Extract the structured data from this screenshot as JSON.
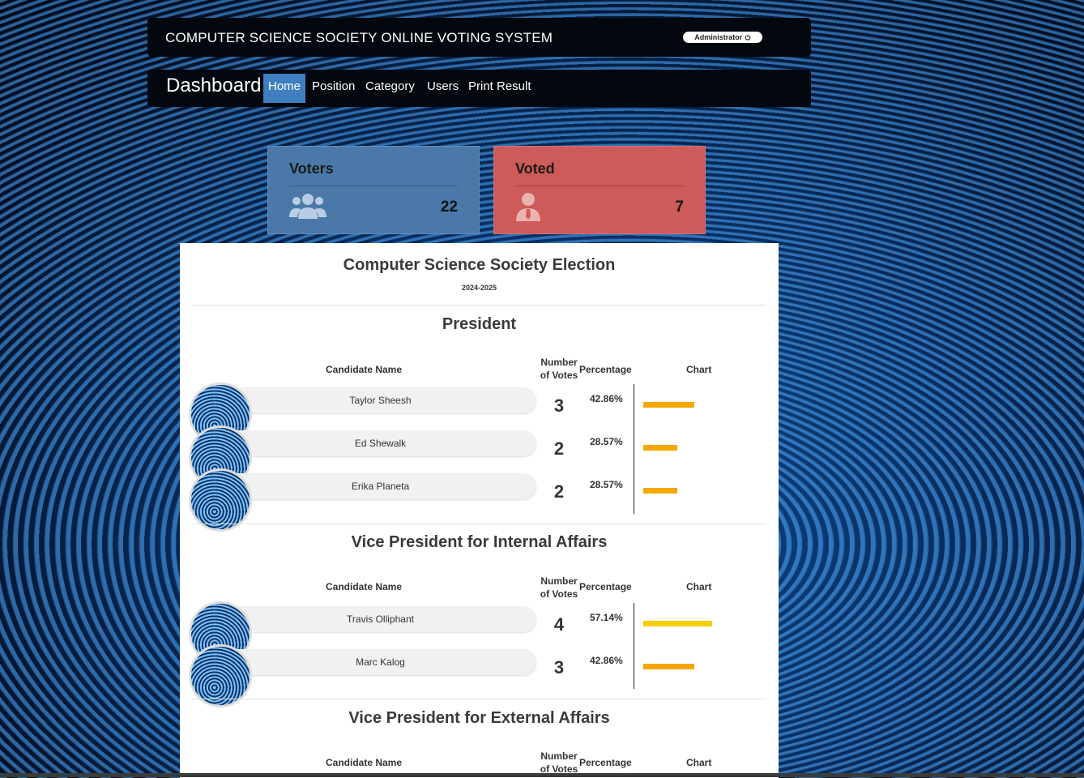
{
  "header": {
    "title": "COMPUTER SCIENCE SOCIETY ONLINE VOTING SYSTEM",
    "admin_label": "Administrator",
    "admin_icon": "power-icon"
  },
  "nav": {
    "brand": "Dashboard",
    "items": [
      {
        "label": "Home",
        "active": true
      },
      {
        "label": "Position",
        "active": false
      },
      {
        "label": "Category",
        "active": false
      },
      {
        "label": "Users",
        "active": false
      },
      {
        "label": "Print Result",
        "active": false
      }
    ]
  },
  "stats": {
    "voters": {
      "label": "Voters",
      "value": "22",
      "icon": "users-icon",
      "color": "#4a79a9"
    },
    "voted": {
      "label": "Voted",
      "value": "7",
      "icon": "user-tie-icon",
      "color": "#cd5b59"
    }
  },
  "election": {
    "title": "Computer Science Society Election",
    "year": "2024-2025",
    "columns": {
      "candidate": "Candidate Name",
      "votes_line1": "Number",
      "votes_line2": "of Votes",
      "percentage": "Percentage",
      "chart": "Chart"
    },
    "positions": [
      {
        "title": "President",
        "candidates": [
          {
            "name": "Taylor Sheesh",
            "votes": "3",
            "percentage": "42.86%",
            "share": 0.4286,
            "bar_color": "#f5a800"
          },
          {
            "name": "Ed Shewalk",
            "votes": "2",
            "percentage": "28.57%",
            "share": 0.2857,
            "bar_color": "#f5a800"
          },
          {
            "name": "Erika Planeta",
            "votes": "2",
            "percentage": "28.57%",
            "share": 0.2857,
            "bar_color": "#f5a800"
          }
        ]
      },
      {
        "title": "Vice President for Internal Affairs",
        "candidates": [
          {
            "name": "Travis Olliphant",
            "votes": "4",
            "percentage": "57.14%",
            "share": 0.5714,
            "bar_color": "#f5d000"
          },
          {
            "name": "Marc Kalog",
            "votes": "3",
            "percentage": "42.86%",
            "share": 0.4286,
            "bar_color": "#f5a800"
          }
        ]
      },
      {
        "title": "Vice President for External Affairs",
        "candidates": []
      }
    ]
  }
}
